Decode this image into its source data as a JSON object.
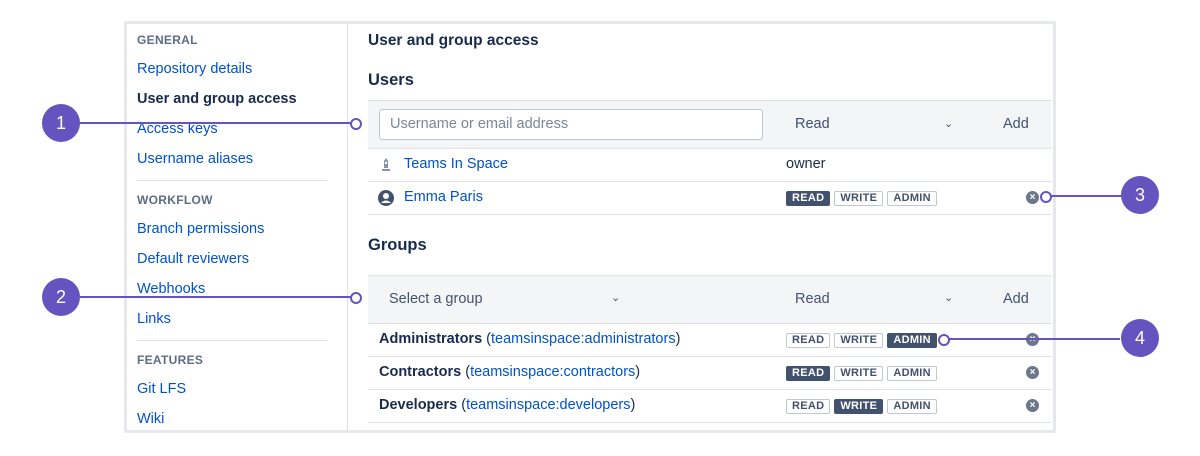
{
  "sidebar": {
    "general_label": "GENERAL",
    "general_items": [
      "Repository details",
      "User and group access",
      "Access keys",
      "Username aliases"
    ],
    "workflow_label": "WORKFLOW",
    "workflow_items": [
      "Branch permissions",
      "Default reviewers",
      "Webhooks",
      "Links"
    ],
    "features_label": "FEATURES",
    "features_items": [
      "Git LFS",
      "Wiki"
    ]
  },
  "main": {
    "title": "User and group access",
    "users_heading": "Users",
    "user_input_placeholder": "Username or email address",
    "user_perm_select": "Read",
    "add_label": "Add",
    "users": [
      {
        "name": "Teams In Space",
        "role": "owner",
        "icon": "team-icon"
      },
      {
        "name": "Emma Paris",
        "icon": "user-avatar-icon",
        "perm": "READ"
      }
    ],
    "groups_heading": "Groups",
    "group_select": "Select a group",
    "group_perm_select": "Read",
    "groups": [
      {
        "name": "Administrators",
        "slug": "teamsinspace:administrators",
        "perm": "ADMIN"
      },
      {
        "name": "Contractors",
        "slug": "teamsinspace:contractors",
        "perm": "READ"
      },
      {
        "name": "Developers",
        "slug": "teamsinspace:developers",
        "perm": "WRITE"
      }
    ],
    "perm_labels": [
      "READ",
      "WRITE",
      "ADMIN"
    ],
    "open_paren": "(",
    "close_paren": ")"
  },
  "callouts": [
    "1",
    "2",
    "3",
    "4"
  ],
  "colors": {
    "accent": "#6554c0",
    "link": "#0052cc",
    "badge_active": "#42526e"
  }
}
